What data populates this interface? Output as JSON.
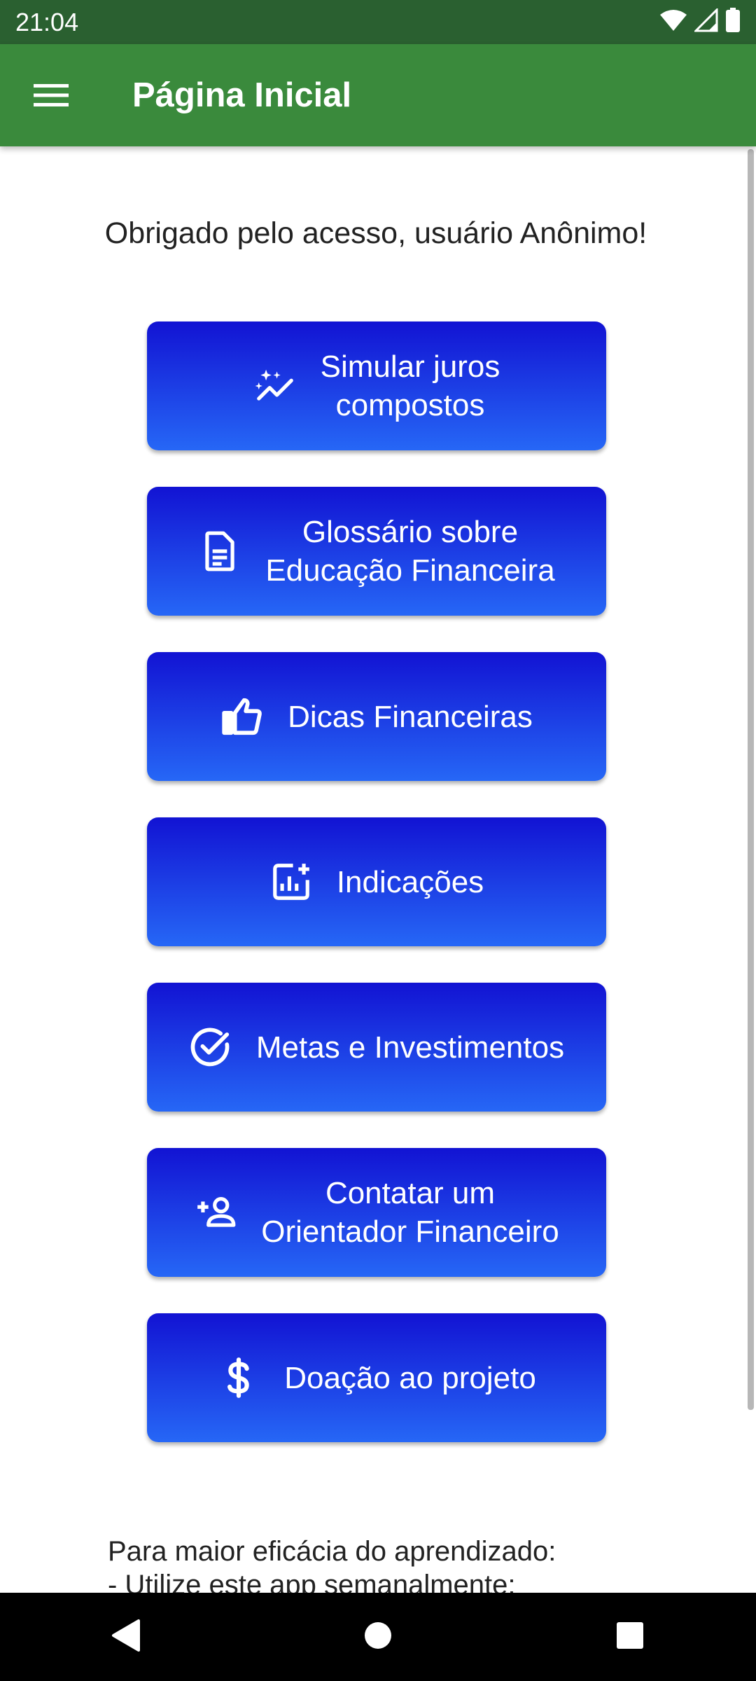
{
  "status_bar": {
    "time": "21:04",
    "icons": [
      "wifi-icon",
      "signal-icon",
      "battery-icon"
    ]
  },
  "app_bar": {
    "title": "Página Inicial",
    "menu_icon": "menu-icon"
  },
  "greeting": "Obrigado pelo acesso, usuário Anônimo!",
  "buttons": [
    {
      "label": "Simular juros\ncompostos",
      "icon": "sparkle-chart-icon"
    },
    {
      "label": "Glossário sobre\nEducação Financeira",
      "icon": "document-icon"
    },
    {
      "label": "Dicas Financeiras",
      "icon": "thumb-up-icon"
    },
    {
      "label": "Indicações",
      "icon": "add-chart-icon"
    },
    {
      "label": "Metas e Investimentos",
      "icon": "check-circle-icon"
    },
    {
      "label": "Contatar um\nOrientador Financeiro",
      "icon": "person-add-icon"
    },
    {
      "label": "Doação ao projeto",
      "icon": "dollar-icon"
    }
  ],
  "tips": "Para maior eficácia do aprendizado:\n- Utilize este app semanalmente;",
  "colors": {
    "status_bar": "#2a6030",
    "app_bar": "#3a8a3c",
    "button_top": "#1213d3",
    "button_bottom": "#2667f6"
  },
  "nav_bar": {
    "back": "back-icon",
    "home": "home-icon",
    "recents": "recents-icon"
  }
}
